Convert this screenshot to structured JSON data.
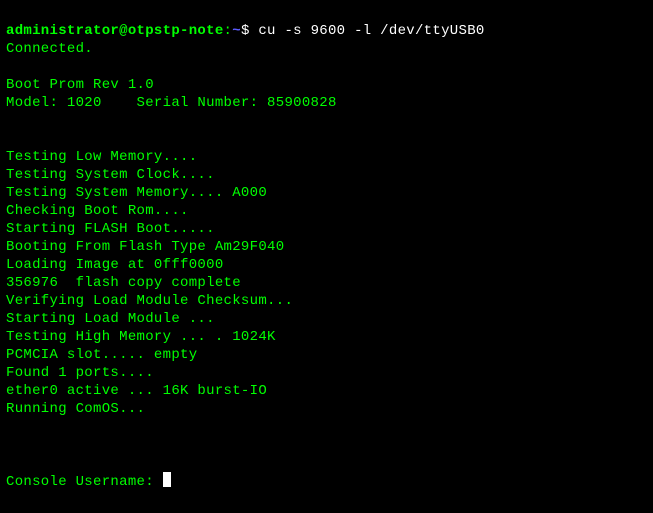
{
  "prompt": {
    "user_host": "administrator@otpstp-note",
    "sep": ":",
    "tilde": "~",
    "dollar": "$",
    "command": "cu -s 9600 -l /dev/ttyUSB0"
  },
  "output": {
    "connected": "Connected.",
    "blank1": "",
    "boot_prom": "Boot Prom Rev 1.0",
    "model_line": "Model: 1020    Serial Number: 85900828",
    "blank2": "",
    "blank3": "",
    "test_low": "Testing Low Memory....",
    "test_clock": "Testing System Clock....",
    "test_sys_mem": "Testing System Memory.... A000",
    "check_boot": "Checking Boot Rom....",
    "start_flash": "Starting FLASH Boot.....",
    "boot_flash": "Booting From Flash Type Am29F040",
    "load_image": "Loading Image at 0fff0000",
    "flash_copy": "356976  flash copy complete",
    "verify": "Verifying Load Module Checksum...",
    "start_load": "Starting Load Module ...",
    "test_high": "Testing High Memory ... . 1024K",
    "pcmcia": "PCMCIA slot..... empty",
    "found_ports": "Found 1 ports....",
    "ether0": "ether0 active ... 16K burst-IO",
    "running": "Running ComOS...",
    "blank4": "",
    "blank5": "",
    "blank6": "",
    "console": "Console Username: "
  }
}
